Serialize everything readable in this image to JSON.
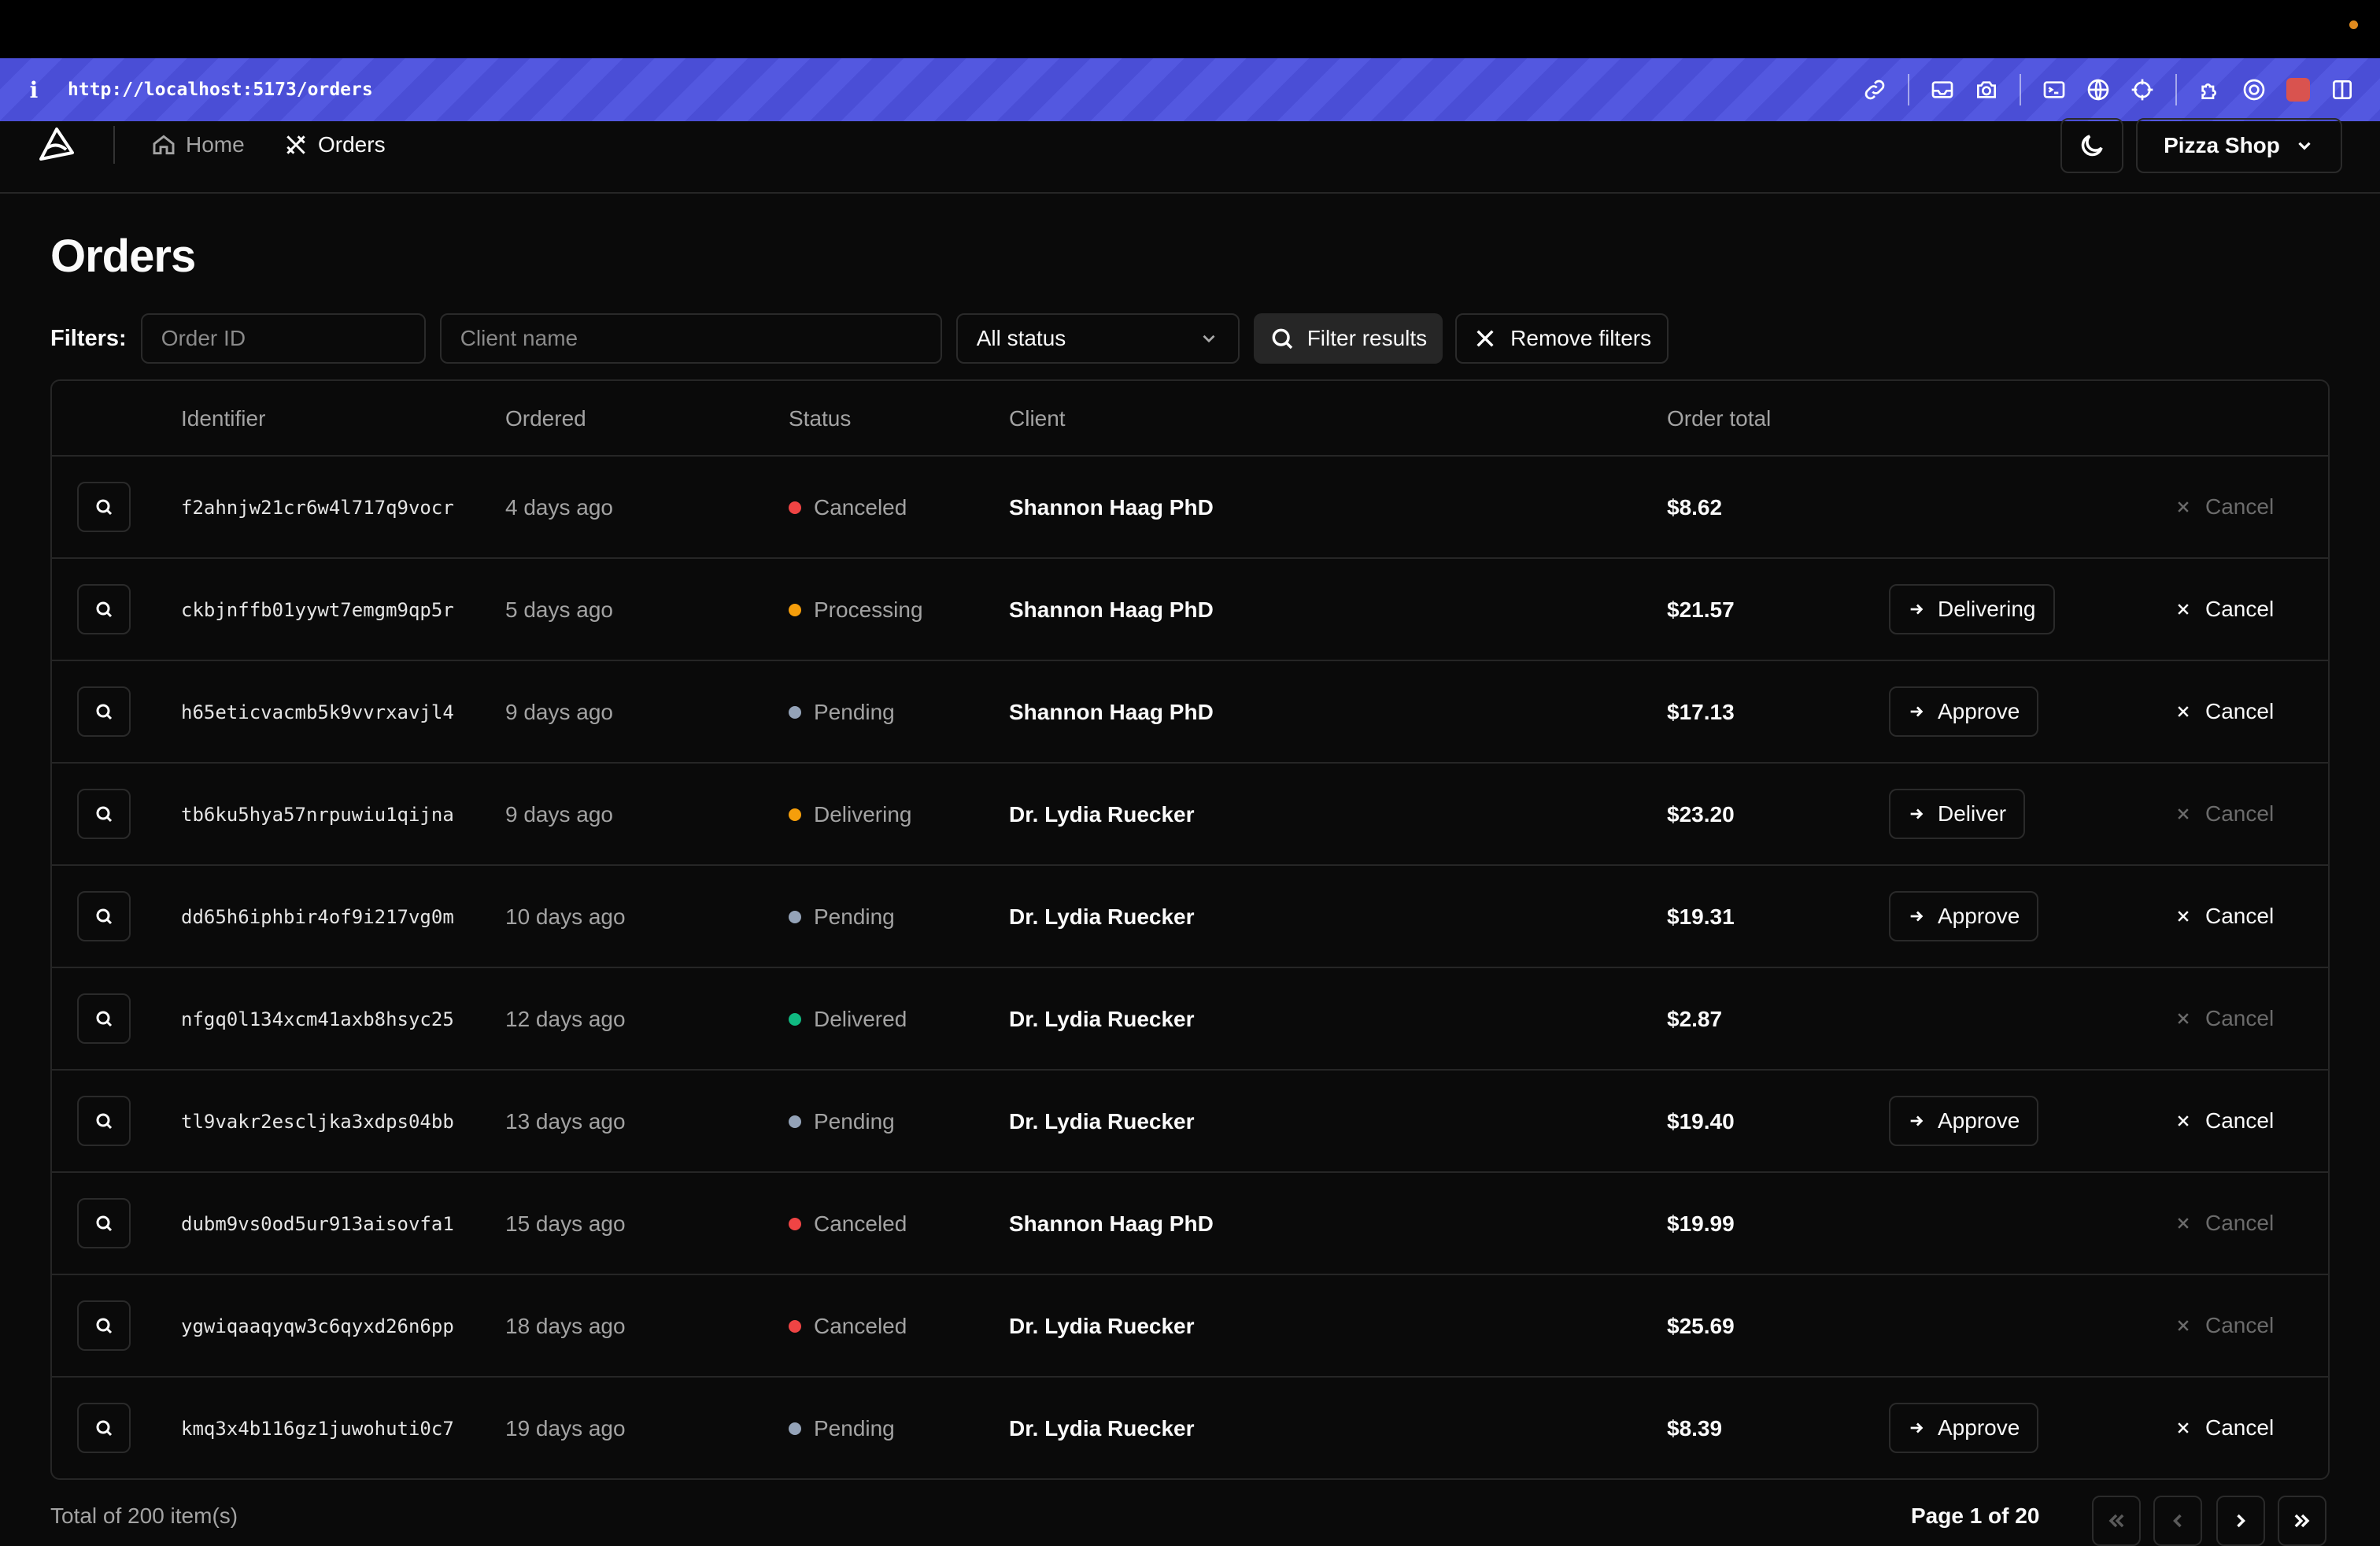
{
  "browser": {
    "url": "http://localhost:5173/orders",
    "info_glyph": "i"
  },
  "nav": {
    "home_label": "Home",
    "orders_label": "Orders",
    "shop_label": "Pizza Shop"
  },
  "page": {
    "title": "Orders"
  },
  "filters": {
    "label": "Filters:",
    "order_id_placeholder": "Order ID",
    "client_placeholder": "Client name",
    "status_selected": "All status",
    "filter_button": "Filter results",
    "remove_button": "Remove filters"
  },
  "table": {
    "headers": [
      "Identifier",
      "Ordered",
      "Status",
      "Client",
      "Order total"
    ],
    "rows": [
      {
        "id": "f2ahnjw21cr6w4l717q9vocr",
        "ordered": "4 days ago",
        "status": "Canceled",
        "status_color": "#ef4444",
        "client": "Shannon Haag PhD",
        "total": "$8.62",
        "action": "",
        "cancel": "Cancel",
        "cancel_enabled": false
      },
      {
        "id": "ckbjnffb01yywt7emgm9qp5r",
        "ordered": "5 days ago",
        "status": "Processing",
        "status_color": "#f59e0b",
        "client": "Shannon Haag PhD",
        "total": "$21.57",
        "action": "Delivering",
        "cancel": "Cancel",
        "cancel_enabled": true
      },
      {
        "id": "h65eticvacmb5k9vvrxavjl4",
        "ordered": "9 days ago",
        "status": "Pending",
        "status_color": "#94a3b8",
        "client": "Shannon Haag PhD",
        "total": "$17.13",
        "action": "Approve",
        "cancel": "Cancel",
        "cancel_enabled": true
      },
      {
        "id": "tb6ku5hya57nrpuwiu1qijna",
        "ordered": "9 days ago",
        "status": "Delivering",
        "status_color": "#f59e0b",
        "client": "Dr. Lydia Ruecker",
        "total": "$23.20",
        "action": "Deliver",
        "cancel": "Cancel",
        "cancel_enabled": false
      },
      {
        "id": "dd65h6iphbir4of9i217vg0m",
        "ordered": "10 days ago",
        "status": "Pending",
        "status_color": "#94a3b8",
        "client": "Dr. Lydia Ruecker",
        "total": "$19.31",
        "action": "Approve",
        "cancel": "Cancel",
        "cancel_enabled": true
      },
      {
        "id": "nfgq0l134xcm41axb8hsyc25",
        "ordered": "12 days ago",
        "status": "Delivered",
        "status_color": "#10b981",
        "client": "Dr. Lydia Ruecker",
        "total": "$2.87",
        "action": "",
        "cancel": "Cancel",
        "cancel_enabled": false
      },
      {
        "id": "tl9vakr2escljka3xdps04bb",
        "ordered": "13 days ago",
        "status": "Pending",
        "status_color": "#94a3b8",
        "client": "Dr. Lydia Ruecker",
        "total": "$19.40",
        "action": "Approve",
        "cancel": "Cancel",
        "cancel_enabled": true
      },
      {
        "id": "dubm9vs0od5ur913aisovfa1",
        "ordered": "15 days ago",
        "status": "Canceled",
        "status_color": "#ef4444",
        "client": "Shannon Haag PhD",
        "total": "$19.99",
        "action": "",
        "cancel": "Cancel",
        "cancel_enabled": false
      },
      {
        "id": "ygwiqaaqyqw3c6qyxd26n6pp",
        "ordered": "18 days ago",
        "status": "Canceled",
        "status_color": "#ef4444",
        "client": "Dr. Lydia Ruecker",
        "total": "$25.69",
        "action": "",
        "cancel": "Cancel",
        "cancel_enabled": false
      },
      {
        "id": "kmq3x4b116gz1juwohuti0c7",
        "ordered": "19 days ago",
        "status": "Pending",
        "status_color": "#94a3b8",
        "client": "Dr. Lydia Ruecker",
        "total": "$8.39",
        "action": "Approve",
        "cancel": "Cancel",
        "cancel_enabled": true
      }
    ]
  },
  "pagination": {
    "total_text": "Total of 200 item(s)",
    "page_text": "Page 1 of 20"
  },
  "icons": {
    "toolbar": [
      "link-icon",
      "inbox-icon",
      "camera-icon",
      "terminal-icon",
      "globe-icon",
      "crosshair-icon",
      "extension-icon",
      "target-icon",
      "avatar-icon",
      "panel-icon"
    ]
  }
}
